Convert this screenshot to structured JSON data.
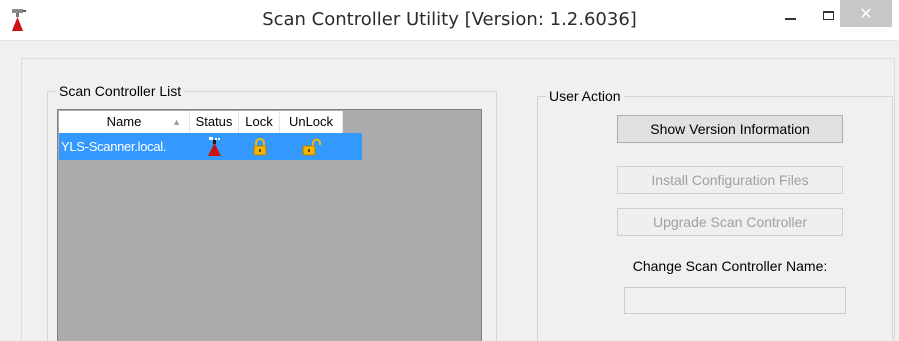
{
  "window": {
    "title": "Scan Controller Utility [Version: 1.2.6036]",
    "close_glyph": "✕"
  },
  "icons": {
    "app": "scanner-icon",
    "status": "scanner-icon",
    "lock": "lock-closed-icon",
    "unlock": "lock-open-icon"
  },
  "colors": {
    "selection": "#3399ff",
    "list_background": "#ababab",
    "scanner_red": "#cc1111",
    "lock_gold": "#f2b705"
  },
  "scan_controller_list": {
    "legend": "Scan Controller List",
    "columns": [
      "Name",
      "Status",
      "Lock",
      "UnLock"
    ],
    "rows": [
      {
        "name": "YLS-Scanner.local.",
        "selected": true
      }
    ]
  },
  "user_action": {
    "legend": "User Action",
    "show_version_label": "Show Version Information",
    "install_config_label": "Install Configuration Files",
    "upgrade_label": "Upgrade Scan Controller",
    "change_name_label": "Change Scan Controller Name:",
    "name_input_value": ""
  }
}
